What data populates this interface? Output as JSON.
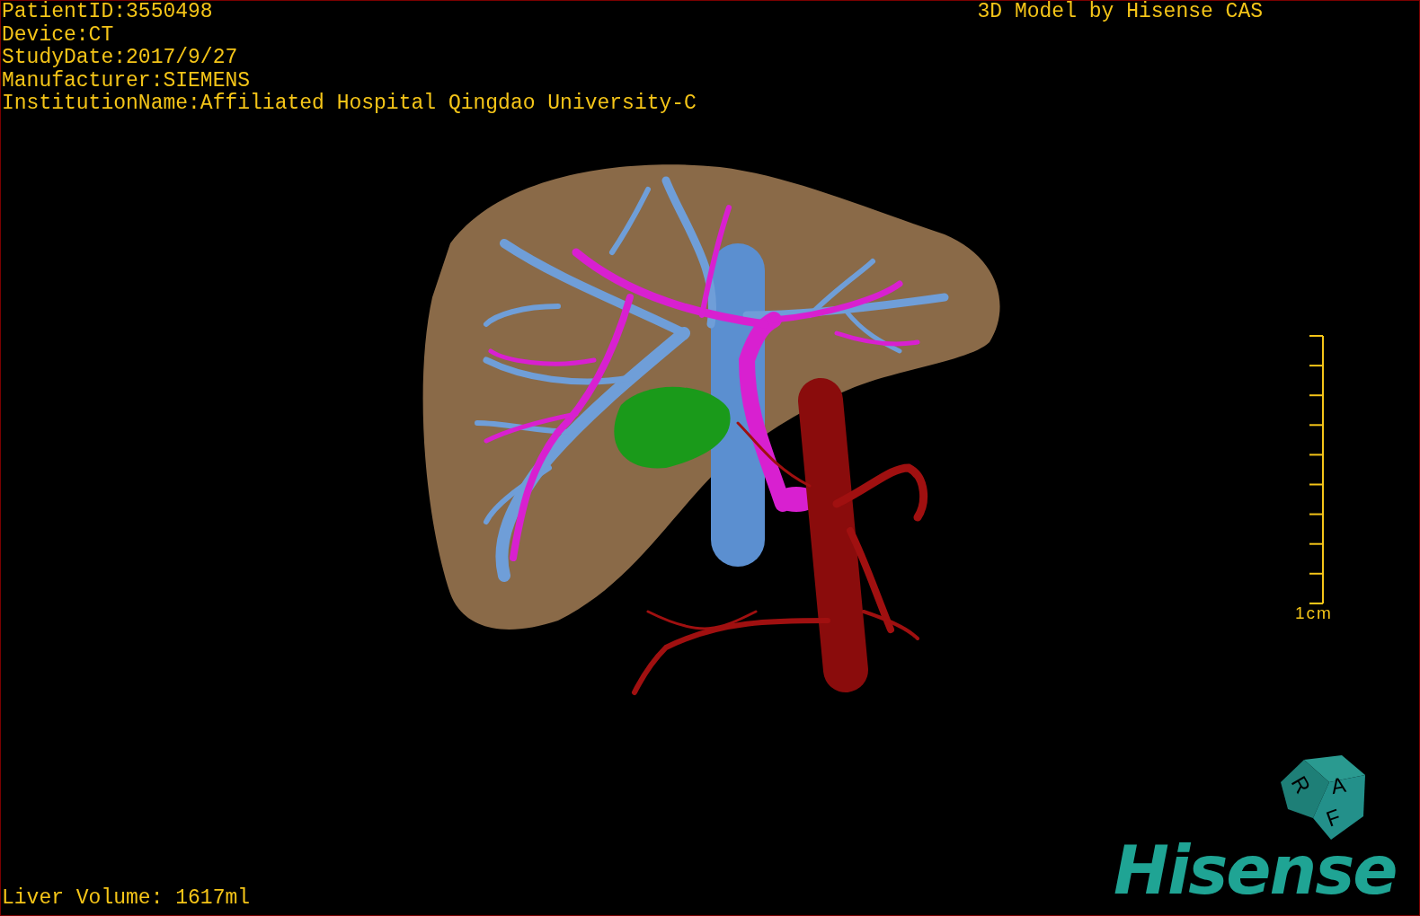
{
  "info_lines": [
    "PatientID:3550498",
    "Device:CT",
    "StudyDate:2017/9/27",
    "Manufacturer:SIEMENS",
    "InstitutionName:Affiliated Hospital Qingdao University-C"
  ],
  "title": "3D Model by Hisense CAS",
  "scale_bar": {
    "label": "1cm"
  },
  "orientation_cube": {
    "faces": [
      "A",
      "R",
      "F"
    ]
  },
  "logo": "Hisense",
  "liver_volume": "Liver Volume: 1617ml"
}
